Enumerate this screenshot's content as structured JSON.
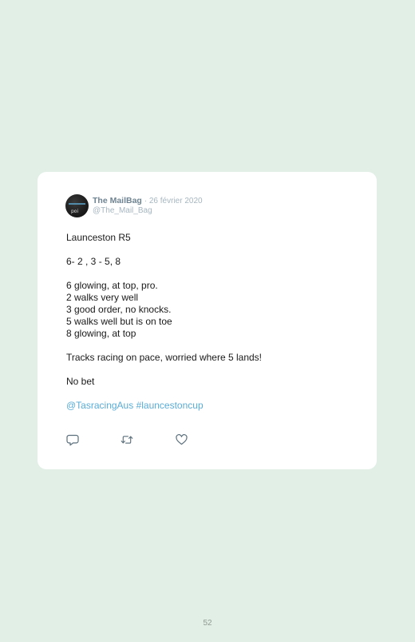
{
  "tweet": {
    "display_name": "The MailBag",
    "date": "· 26 février 2020",
    "handle": "@The_Mail_Bag",
    "avatar_text": "poi",
    "title_line": "Launceston R5",
    "selection_line": "6- 2 , 3 - 5, 8",
    "notes": [
      "6 glowing, at top, pro.",
      "2 walks very well",
      "3 good order, no knocks.",
      "5 walks well but is on toe",
      "8 glowing, at top"
    ],
    "comment_line": "Tracks racing on pace, worried where 5 lands!",
    "bet_line": "No bet",
    "mention": "@TasracingAus",
    "hashtag": "#launcestoncup"
  },
  "actions": {
    "reply_icon": "reply-icon",
    "retweet_icon": "retweet-icon",
    "like_icon": "heart-icon"
  },
  "colors": {
    "background": "#e1efe6",
    "card": "#ffffff",
    "link": "#5aacd6",
    "name": "#6e8391",
    "meta": "#a6b6c0",
    "icon": "#5b6f7c"
  },
  "page": {
    "number": "52"
  }
}
